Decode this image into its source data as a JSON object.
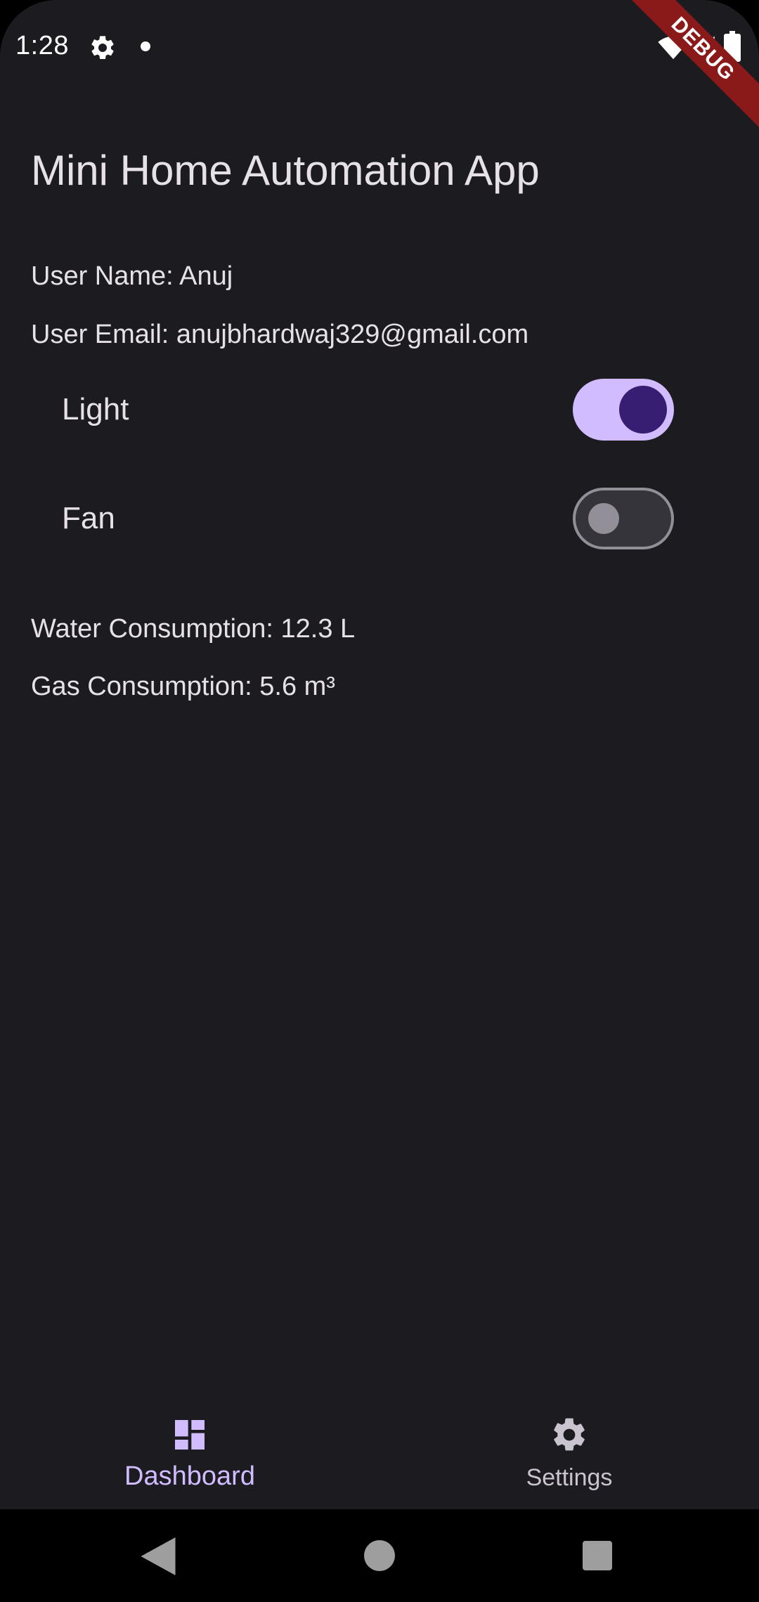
{
  "status_bar": {
    "time": "1:28",
    "icons": [
      "gear-icon",
      "notification-dot-icon",
      "wifi-icon",
      "signal-icon",
      "battery-icon"
    ]
  },
  "debug_banner": {
    "label": "DEBUG",
    "color": "#8a1a1a"
  },
  "app": {
    "title": "Mini Home Automation App",
    "user_name": "User Name: Anuj",
    "user_email": "User Email: anujbhardwaj329@gmail.com",
    "toggles": [
      {
        "label": "Light",
        "state": "on"
      },
      {
        "label": "Fan",
        "state": "off"
      }
    ],
    "water_consumption": "Water Consumption: 12.3 L",
    "gas_consumption": "Gas Consumption: 5.6 m³"
  },
  "bottom_nav": {
    "items": [
      {
        "label": "Dashboard",
        "icon": "dashboard-icon",
        "selected": true
      },
      {
        "label": "Settings",
        "icon": "settings-icon",
        "selected": false
      }
    ]
  },
  "colors": {
    "background": "#1c1b20",
    "text": "#e6e1e9",
    "accent": "#d0bcff",
    "switch_thumb_on": "#381e72",
    "switch_off_outline": "#938f99"
  }
}
